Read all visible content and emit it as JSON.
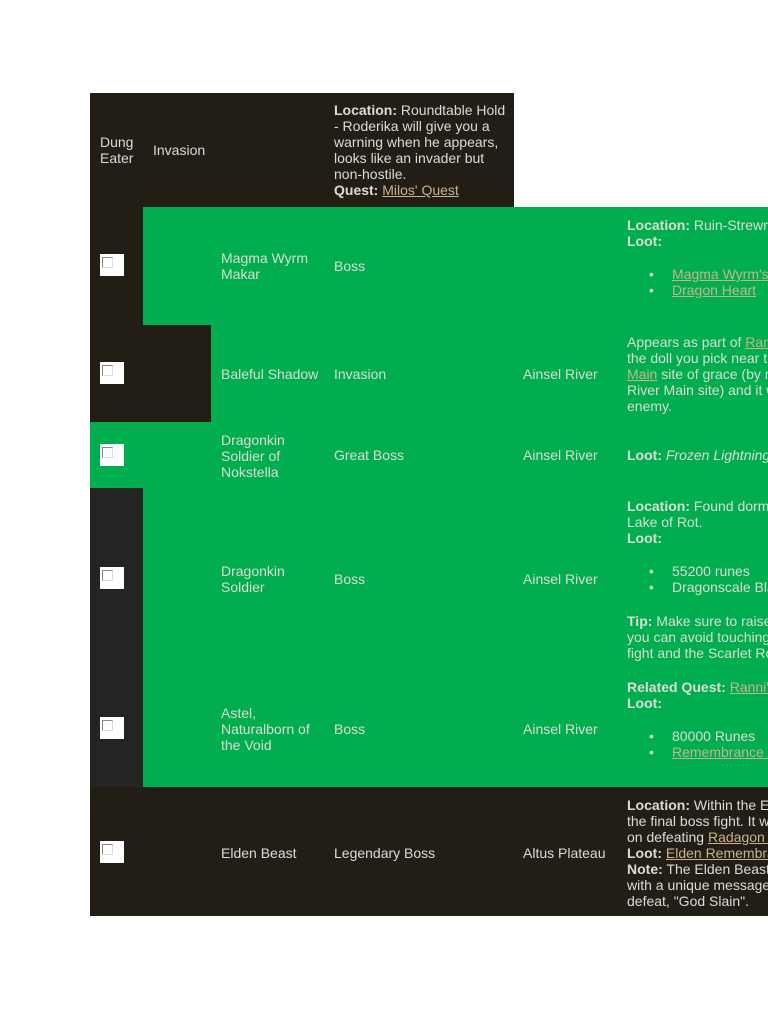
{
  "rows": [
    {
      "name": "Dung Eater",
      "type": "Invasion",
      "notes": {
        "loc_label": "Location:",
        "loc_text": "Roundtable Hold - Roderika will give you a warning when he appears, looks like an invader but non-hostile.",
        "quest_label": "Quest:",
        "quest_link": "Milos' Quest"
      }
    },
    {
      "name": "Magma Wyrm Makar",
      "type": "Boss",
      "location": "",
      "notes": {
        "loc_label": "Location:",
        "loc_text": "Ruin-Strewn P",
        "loot_label": "Loot:",
        "loot": [
          "Magma Wyrm's S",
          "Dragon Heart"
        ]
      }
    },
    {
      "name": "Baleful Shadow",
      "type": "Invasion",
      "location": "Ainsel River",
      "notes": {
        "t1": "Appears as part of ",
        "link1": "Ranni",
        "t2": "the doll you pick near the",
        "link2": "Main",
        "t3": " site of grace (by re",
        "t4": "River Main site) and it w",
        "t5": "enemy."
      }
    },
    {
      "name": "Dragonkin Soldier of Nokstella",
      "type": "Great Boss",
      "location": "Ainsel River",
      "notes": {
        "loot_label": "Loot:",
        "loot_text": "Frozen Lightning S"
      }
    },
    {
      "name": "Dragonkin Soldier",
      "type": "Boss",
      "location": "Ainsel River",
      "notes": {
        "loc_label": "Location:",
        "loc_text": "Found dorma",
        "loc_text2": "Lake of Rot.",
        "loot_label": "Loot:",
        "loot": [
          "55200 runes",
          "Dragonscale Bla"
        ],
        "tip_label": "Tip:",
        "tip_lines": [
          "Make sure to raise a",
          "you can avoid touching t",
          "fight and the Scarlet Rot"
        ]
      }
    },
    {
      "name": "Astel, Naturalborn of the Void",
      "type": "Boss",
      "location": "Ainsel River",
      "notes": {
        "quest_label": "Related Quest:",
        "quest_link": "Ranni's",
        "loot_label": "Loot:",
        "loot_plain": "80000 Runes",
        "loot_link": "Remembrance o"
      }
    },
    {
      "name": "Elden Beast",
      "type": "Legendary Boss",
      "location": "Altus Plateau",
      "notes": {
        "loc_label": "Location:",
        "l1": "Within the Erd",
        "l2": "the final boss fight. It will",
        "l3": "on defeating ",
        "l3_link": "Radagon o",
        "loot_label": "Loot:",
        "loot_link": "Elden Remembran",
        "note_label": "Note:",
        "n1": "The Elden Beast i",
        "n2": "with a unique message a",
        "n3": "defeat, \"God Slain\"."
      }
    }
  ]
}
